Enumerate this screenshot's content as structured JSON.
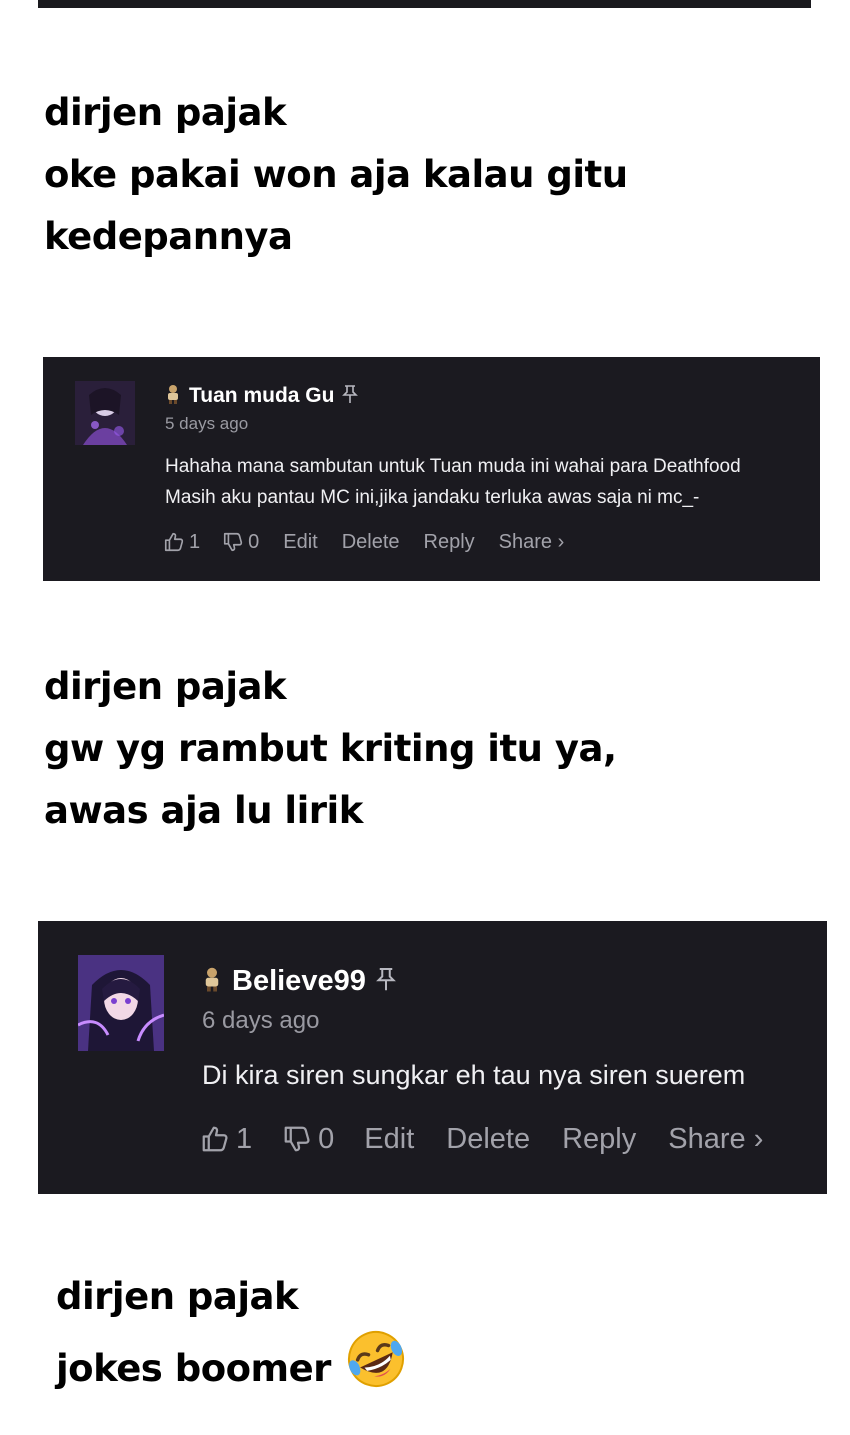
{
  "notes": [
    {
      "lines": [
        "dirjen pajak",
        "oke pakai won aja kalau gitu",
        "kedepannya"
      ]
    },
    {
      "lines": [
        "dirjen pajak",
        "gw yg rambut kriting itu ya,",
        "awas aja lu lirik"
      ]
    },
    {
      "lines": [
        "dirjen pajak",
        "jokes boomer"
      ]
    }
  ],
  "comments": [
    {
      "username": "Tuan muda Gu",
      "time": "5 days ago",
      "body": [
        "Hahaha mana sambutan untuk Tuan muda ini wahai para Deathfood",
        "Masih aku pantau MC ini,jika jandaku terluka awas saja ni mc_-"
      ],
      "likes": "1",
      "dislikes": "0",
      "actions": {
        "edit": "Edit",
        "delete": "Delete",
        "reply": "Reply",
        "share": "Share ›"
      }
    },
    {
      "username": "Believe99",
      "time": "6 days ago",
      "body": [
        "Di kira siren sungkar eh tau nya siren suerem"
      ],
      "likes": "1",
      "dislikes": "0",
      "actions": {
        "edit": "Edit",
        "delete": "Delete",
        "reply": "Reply",
        "share": "Share ›"
      }
    }
  ],
  "icons": {
    "badge": "person-badge-icon",
    "pin": "pin-icon",
    "like": "thumbs-up-icon",
    "dislike": "thumbs-down-icon",
    "emoji": "rolling-on-floor-laughing-emoji"
  },
  "colors": {
    "card_bg": "#1b1a20",
    "page_bg": "#ffffff",
    "muted": "#9a9aa2"
  }
}
